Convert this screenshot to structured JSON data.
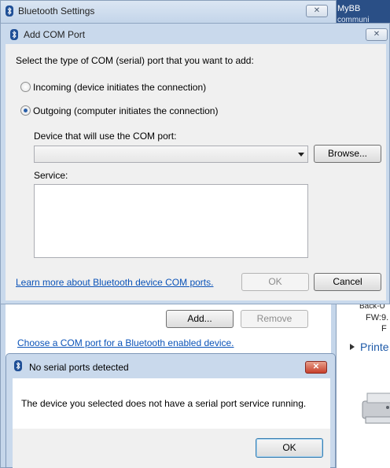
{
  "background_window": {
    "header_text": "MyBB",
    "header_subtext": "communi",
    "device_line": "Back-U",
    "firmware": "FW:9.",
    "firmware_cont": "F",
    "section_label": "Printe",
    "printer_icon": "printer-icon"
  },
  "bt_settings": {
    "title": "Bluetooth Settings",
    "close_label": "✕",
    "add_label": "Add...",
    "remove_label": "Remove",
    "choose_link": "Choose a COM port for a Bluetooth enabled device.",
    "icon": "bluetooth-icon"
  },
  "add_com": {
    "title": "Add COM Port",
    "close_label": "✕",
    "prompt": "Select the type of COM (serial) port that you want to add:",
    "incoming_label": "Incoming (device initiates the connection)",
    "outgoing_label": "Outgoing (computer initiates the connection)",
    "selected": "outgoing",
    "device_label": "Device that will use the COM port:",
    "device_value": "",
    "browse_label": "Browse...",
    "service_label": "Service:",
    "service_value": "",
    "learn_link": "Learn more about Bluetooth device COM ports.",
    "ok_label": "OK",
    "cancel_label": "Cancel",
    "icon": "bluetooth-icon"
  },
  "no_serial": {
    "title": "No serial ports detected",
    "close_label": "✕",
    "message": "The device you selected does not have a serial port service running.",
    "ok_label": "OK",
    "icon": "bluetooth-icon"
  },
  "colors": {
    "link": "#0b53b8",
    "frame": "#c9d9ec",
    "close_red": "#c7402c"
  }
}
